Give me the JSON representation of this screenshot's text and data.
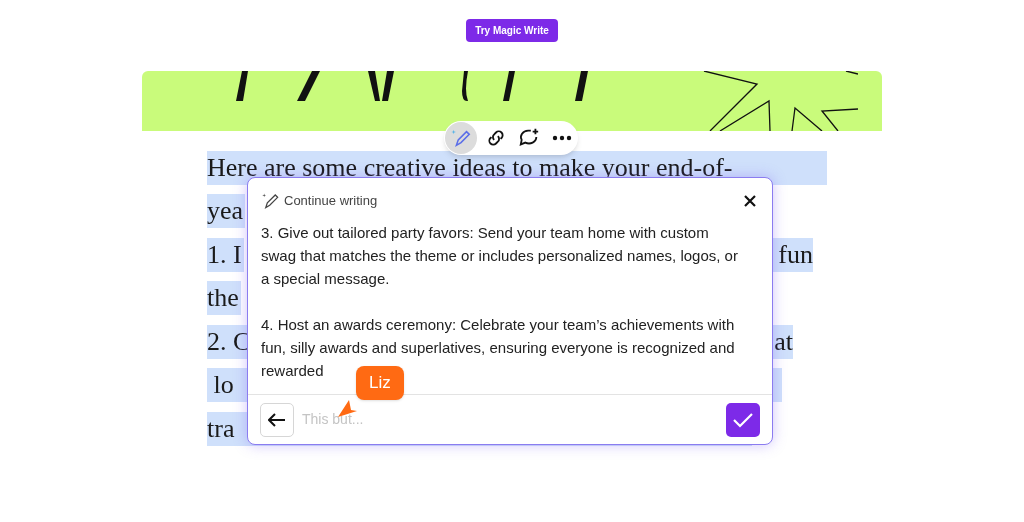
{
  "top_button": "Try Magic Write",
  "document_lines": [
    {
      "left": "Here are some creative ideas to make your end-of-"
    },
    {
      "left": "yea"
    },
    {
      "left": "1. I",
      "right": "fun"
    },
    {
      "left": "the"
    },
    {
      "left": "2. C",
      "right": "at"
    },
    {
      "left": " lo"
    },
    {
      "left": "tra"
    }
  ],
  "popup": {
    "title": "Continue writing",
    "paragraphs": [
      "3. Give out tailored party favors: Send your team home with custom swag that matches the theme or includes personalized names, logos, or a special message.",
      "4. Host an awards ceremony: Celebrate your team’s achievements with fun, silly awards and superlatives, ensuring everyone is recognized and rewarded"
    ],
    "input": {
      "placeholder": "This but..."
    }
  },
  "cursor": {
    "label": "Liz",
    "color": "#ff6a13"
  }
}
